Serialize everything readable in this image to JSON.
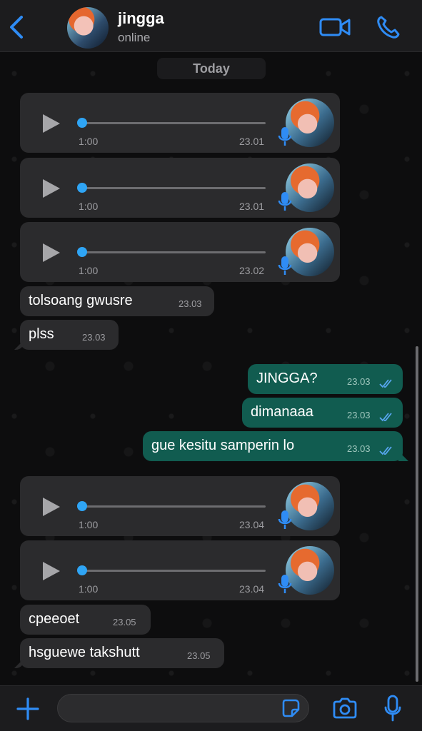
{
  "header": {
    "contact_name": "jingga",
    "status": "online"
  },
  "chat": {
    "day_label": "Today",
    "voice_messages": [
      {
        "duration": "1:00",
        "time": "23.01"
      },
      {
        "duration": "1:00",
        "time": "23.01"
      },
      {
        "duration": "1:00",
        "time": "23.02"
      },
      {
        "duration": "1:00",
        "time": "23.04"
      },
      {
        "duration": "1:00",
        "time": "23.04"
      }
    ],
    "messages": [
      {
        "text": "tolsoang gwusre",
        "time": "23.03"
      },
      {
        "text": "plss",
        "time": "23.03"
      },
      {
        "text": "JINGGA?",
        "time": "23.03"
      },
      {
        "text": "dimanaaa",
        "time": "23.03"
      },
      {
        "text": "gue kesitu samperin lo",
        "time": "23.03"
      },
      {
        "text": "cpeeoet",
        "time": "23.05"
      },
      {
        "text": "hsguewe takshutt",
        "time": "23.05"
      }
    ]
  },
  "colors": {
    "accent": "#2f8cf5",
    "outgoing_bubble": "#115c50",
    "incoming_bubble": "#2b2b2d"
  },
  "icons": [
    "chevron-left-icon",
    "video-call-icon",
    "phone-icon",
    "play-icon",
    "microphone-icon",
    "plus-icon",
    "sticker-icon",
    "camera-icon",
    "read-receipt-icon"
  ]
}
